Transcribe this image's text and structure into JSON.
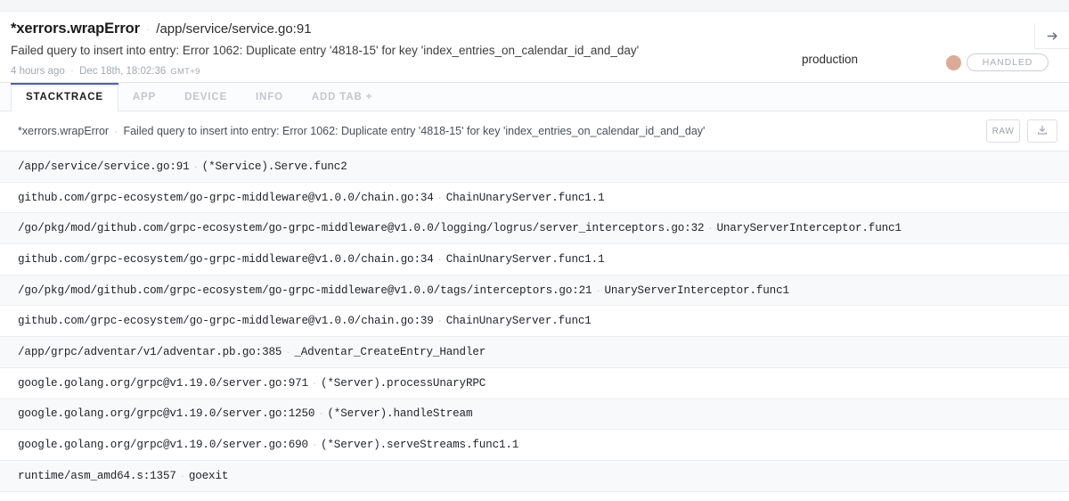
{
  "header": {
    "error_type": "*xerrors.wrapError",
    "separator": "·",
    "error_location": "/app/service/service.go:91",
    "error_message": "Failed query to insert into entry: Error 1062: Duplicate entry '4818-15' for key 'index_entries_on_calendar_id_and_day'",
    "relative_time": "4 hours ago",
    "absolute_time": "Dec 18th, 18:02:36",
    "timezone": "GMT+9",
    "environment": "production",
    "status_label": "HANDLED",
    "status_dot_color": "#dbab95",
    "goto_icon": "arrow-right-icon"
  },
  "tabs": {
    "items": [
      {
        "label": "STACKTRACE",
        "active": true
      },
      {
        "label": "APP",
        "active": false
      },
      {
        "label": "DEVICE",
        "active": false
      },
      {
        "label": "INFO",
        "active": false
      },
      {
        "label": "ADD TAB +",
        "active": false
      }
    ],
    "active_indicator_color": "#4a56e2"
  },
  "subheader": {
    "error_type": "*xerrors.wrapError",
    "separator": "·",
    "error_message": "Failed query to insert into entry: Error 1062: Duplicate entry '4818-15' for key 'index_entries_on_calendar_id_and_day'",
    "raw_label": "RAW",
    "download_icon": "download-icon"
  },
  "stacktrace": {
    "separator": "·",
    "frames": [
      {
        "location": "/app/service/service.go:91",
        "function": "(*Service).Serve.func2"
      },
      {
        "location": "github.com/grpc-ecosystem/go-grpc-middleware@v1.0.0/chain.go:34",
        "function": "ChainUnaryServer.func1.1"
      },
      {
        "location": "/go/pkg/mod/github.com/grpc-ecosystem/go-grpc-middleware@v1.0.0/logging/logrus/server_interceptors.go:32",
        "function": "UnaryServerInterceptor.func1"
      },
      {
        "location": "github.com/grpc-ecosystem/go-grpc-middleware@v1.0.0/chain.go:34",
        "function": "ChainUnaryServer.func1.1"
      },
      {
        "location": "/go/pkg/mod/github.com/grpc-ecosystem/go-grpc-middleware@v1.0.0/tags/interceptors.go:21",
        "function": "UnaryServerInterceptor.func1"
      },
      {
        "location": "github.com/grpc-ecosystem/go-grpc-middleware@v1.0.0/chain.go:39",
        "function": "ChainUnaryServer.func1"
      },
      {
        "location": "/app/grpc/adventar/v1/adventar.pb.go:385",
        "function": "_Adventar_CreateEntry_Handler"
      },
      {
        "location": "google.golang.org/grpc@v1.19.0/server.go:971",
        "function": "(*Server).processUnaryRPC"
      },
      {
        "location": "google.golang.org/grpc@v1.19.0/server.go:1250",
        "function": "(*Server).handleStream"
      },
      {
        "location": "google.golang.org/grpc@v1.19.0/server.go:690",
        "function": "(*Server).serveStreams.func1.1"
      },
      {
        "location": "runtime/asm_amd64.s:1357",
        "function": "goexit"
      }
    ]
  }
}
